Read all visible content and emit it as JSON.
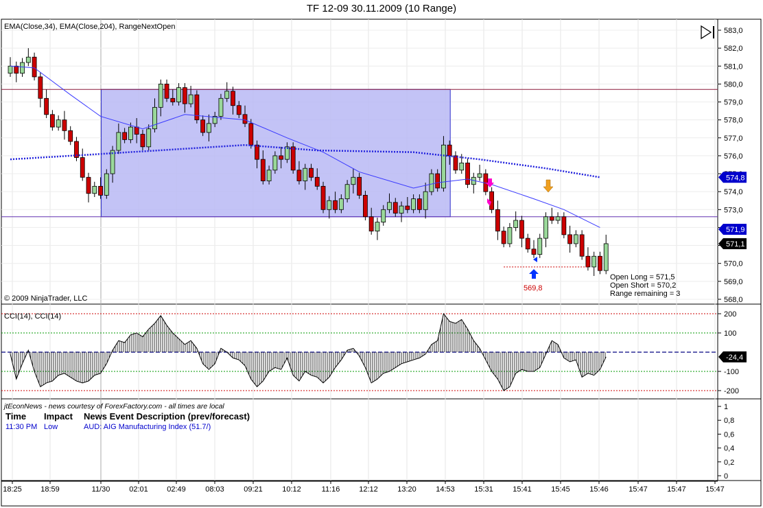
{
  "title": "TF 12-09  30.11.2009 (10 Range)",
  "indicator_label": "EMA(Close,34), EMA(Close,204), RangeNextOpen",
  "copyright": "© 2009 NinjaTrader, LLC",
  "info_lines": [
    "Open Long = 571,5",
    "Open Short = 570,2",
    "Range remaining = 3"
  ],
  "low_label": "569,8",
  "cci_label": "CCI(14), CCI(14)",
  "news": {
    "header": "jtEconNews - news courtesy of ForexFactory.com - all times are local",
    "columns": [
      "Time",
      "Impact",
      "News Event Description (prev/forecast)"
    ],
    "rows": [
      {
        "time": "11:30 PM",
        "impact": "Low",
        "description": "AUD: AIG Manufacturing Index (51.7/)"
      }
    ],
    "axis_labels": [
      "1",
      "0,8",
      "0,6",
      "0,4",
      "0,2",
      "0"
    ]
  },
  "colors": {
    "up": "#9ad89a",
    "down": "#cc0000",
    "ema34": "#3a3aff",
    "ema204": "#2020dd",
    "box": "#b8b8f4",
    "accent": "#0000cc"
  },
  "chart_data": {
    "type": "candlestick",
    "price_axis": {
      "range": [
        568,
        583
      ],
      "labels": [
        "583,0",
        "582,0",
        "581,0",
        "580,0",
        "579,0",
        "578,0",
        "577,0",
        "576,0",
        "575,0",
        "574,0",
        "573,0",
        "572,0",
        "571,0",
        "570,0",
        "569,0",
        "568,0"
      ]
    },
    "price_tags": [
      {
        "label": "574,8",
        "value": 574.8,
        "color": "#0000cc"
      },
      {
        "label": "571,9",
        "value": 571.9,
        "color": "#0000cc"
      },
      {
        "label": "571,1",
        "value": 571.1,
        "color": "#000000"
      }
    ],
    "x_labels": [
      "18:25",
      "18:59",
      "11/30",
      "02:01",
      "02:49",
      "08:03",
      "09:21",
      "10:12",
      "11:16",
      "12:12",
      "13:20",
      "14:53",
      "15:31",
      "15:41",
      "15:45",
      "15:46",
      "15:47",
      "15:47",
      "15:47"
    ],
    "closes": [
      581.0,
      580.6,
      581.2,
      581.5,
      580.4,
      579.2,
      578.3,
      577.6,
      578.0,
      577.4,
      576.8,
      575.9,
      574.8,
      573.9,
      574.3,
      573.8,
      575.0,
      576.3,
      577.3,
      576.9,
      577.6,
      577.2,
      576.5,
      577.5,
      578.7,
      580.0,
      579.2,
      579.0,
      579.8,
      578.9,
      579.4,
      578.0,
      577.3,
      577.8,
      578.2,
      579.2,
      579.6,
      578.8,
      578.3,
      577.8,
      576.6,
      575.8,
      574.6,
      575.2,
      576.0,
      575.8,
      576.5,
      575.2,
      574.6,
      575.3,
      574.8,
      574.3,
      573.0,
      573.5,
      573.0,
      573.6,
      574.4,
      574.8,
      573.8,
      572.6,
      571.8,
      572.3,
      573.0,
      573.4,
      572.8,
      573.2,
      573.0,
      573.6,
      573.0,
      574.0,
      575.0,
      574.2,
      576.6,
      576.0,
      575.2,
      575.6,
      574.4,
      574.8,
      575.0,
      574.0,
      573.0,
      571.8,
      571.1,
      572.0,
      572.4,
      571.4,
      570.8,
      570.5,
      571.4,
      572.6,
      572.4,
      572.6,
      571.6,
      571.1,
      571.6,
      570.4,
      569.8,
      570.4,
      569.6,
      571.1
    ],
    "ema34": [
      [
        0,
        581.0
      ],
      [
        4,
        580.9
      ],
      [
        10,
        579.4
      ],
      [
        15,
        578.2
      ],
      [
        22,
        577.5
      ],
      [
        29,
        578.3
      ],
      [
        39,
        578.0
      ],
      [
        46,
        577.0
      ],
      [
        52,
        576.2
      ],
      [
        58,
        575.1
      ],
      [
        67,
        574.2
      ],
      [
        71,
        574.5
      ],
      [
        76,
        574.7
      ],
      [
        80,
        574.4
      ],
      [
        87,
        573.6
      ],
      [
        92,
        573.0
      ],
      [
        98,
        572.0
      ]
    ],
    "ema204": [
      [
        0,
        575.8
      ],
      [
        15,
        576.1
      ],
      [
        39,
        576.6
      ],
      [
        51,
        576.3
      ],
      [
        67,
        576.2
      ],
      [
        78,
        575.8
      ],
      [
        89,
        575.3
      ],
      [
        98,
        574.8
      ]
    ],
    "range_box": {
      "from_bar": 15,
      "to_bar": 73,
      "low": 572.6,
      "high": 579.7
    },
    "levels": [
      579.7,
      572.6
    ],
    "low_level": {
      "value": 569.8,
      "from_bar": 82,
      "to_bar": 96
    },
    "cci": {
      "axis_labels": [
        "200",
        "100",
        "-100",
        "-200"
      ],
      "current_label": "-24,4",
      "values": [
        -10,
        -140,
        -60,
        10,
        -100,
        -180,
        -160,
        -150,
        -120,
        -110,
        -130,
        -150,
        -160,
        -150,
        -120,
        -110,
        -60,
        10,
        60,
        50,
        90,
        100,
        80,
        120,
        150,
        190,
        140,
        100,
        70,
        40,
        60,
        20,
        -60,
        -90,
        -60,
        20,
        0,
        -30,
        -40,
        -70,
        -140,
        -180,
        -150,
        -100,
        -80,
        -90,
        -30,
        -120,
        -150,
        -100,
        -120,
        -130,
        -160,
        -130,
        -80,
        -40,
        10,
        20,
        -20,
        -80,
        -160,
        -140,
        -110,
        -100,
        -80,
        -60,
        -50,
        -40,
        -30,
        -10,
        40,
        60,
        200,
        160,
        150,
        170,
        120,
        60,
        20,
        -40,
        -100,
        -140,
        -200,
        -180,
        -110,
        -90,
        -100,
        -100,
        -80,
        -10,
        60,
        40,
        -30,
        -50,
        -40,
        -130,
        -110,
        -120,
        -90,
        -24.4
      ]
    }
  }
}
